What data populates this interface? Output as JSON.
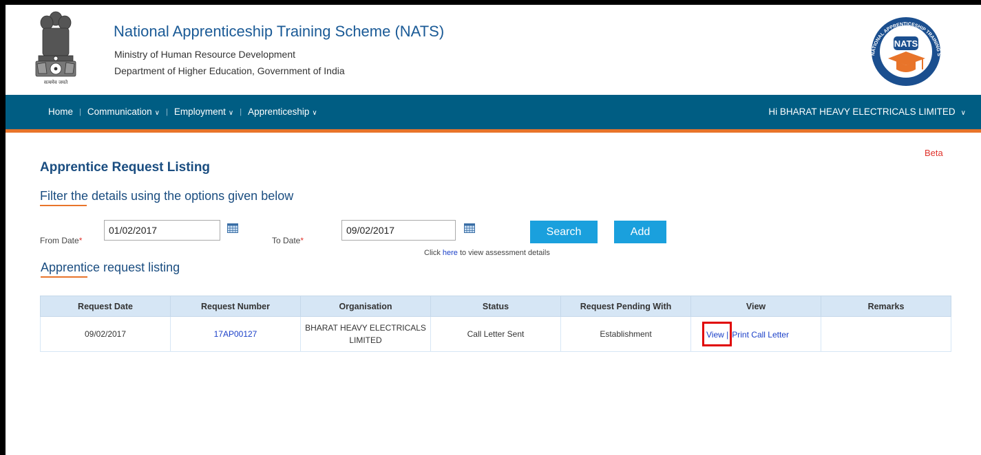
{
  "header": {
    "title": "National Apprenticeship Training Scheme (NATS)",
    "subtitle1": "Ministry of Human Resource Development",
    "subtitle2": "Department of Higher Education, Government of India",
    "emblem_caption": "सत्यमेव जयते",
    "logo_text": "NATS",
    "logo_ring_text": "NATIONAL APPRENTICESHIP TRAINING SCHEME"
  },
  "nav": {
    "items": [
      {
        "label": "Home"
      },
      {
        "label": "Communication"
      },
      {
        "label": "Employment"
      },
      {
        "label": "Apprenticeship"
      }
    ],
    "user": "Hi BHARAT HEAVY ELECTRICALS LIMITED"
  },
  "beta": "Beta",
  "page_title": "Apprentice Request Listing",
  "filter": {
    "title": "Filter the details using the options given below",
    "from_label": "From Date",
    "from_value": "01/02/2017",
    "to_label": "To Date",
    "to_value": "09/02/2017",
    "required_mark": "*",
    "search_label": "Search",
    "add_label": "Add"
  },
  "hint": {
    "prefix": "Click ",
    "link": "here",
    "suffix": " to view assessment details"
  },
  "listing": {
    "title": "Apprentice request listing",
    "columns": [
      "Request Date",
      "Request Number",
      "Organisation",
      "Status",
      "Request Pending With",
      "View",
      "Remarks"
    ],
    "rows": [
      {
        "date": "09/02/2017",
        "number": "17AP00127",
        "organisation_line1": "BHARAT HEAVY ELECTRICALS",
        "organisation_line2": "LIMITED",
        "status": "Call Letter Sent",
        "pending_with": "Establishment",
        "view_label": "View",
        "separator": "|",
        "print_label": "Print Call Letter",
        "remarks": ""
      }
    ]
  },
  "colors": {
    "nav_bg": "#005d83",
    "accent_orange": "#e8742a",
    "button_blue": "#1aa0dd",
    "title_blue": "#1a4d80",
    "highlight_red": "#e00000"
  }
}
